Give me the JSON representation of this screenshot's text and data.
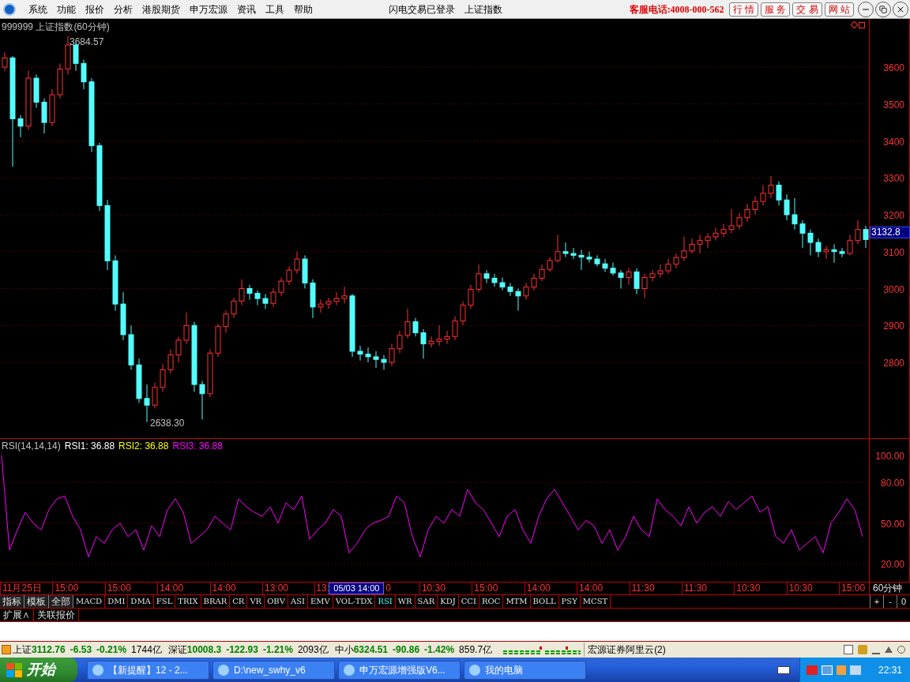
{
  "menu": {
    "items": [
      "系统",
      "功能",
      "报价",
      "分析",
      "港股期货",
      "申万宏源",
      "资讯",
      "工具",
      "帮助"
    ],
    "status": [
      "闪电交易已登录",
      "上证指数"
    ],
    "hotline": "客服电话:4008-000-562",
    "quick_buttons": [
      "行 情",
      "服 务",
      "交 易",
      "网 站"
    ]
  },
  "chart": {
    "title": "999999 上证指数(60分钟)",
    "high_label": "3684.57",
    "low_label": "2638.30",
    "current_price": "3132.8",
    "chart_data": {
      "type": "candlestick",
      "grid": true,
      "ylim": [
        2594.7,
        3730.5
      ],
      "yticks": [
        {
          "value": 3600,
          "label": "3600"
        },
        {
          "value": 3500,
          "label": "3500"
        },
        {
          "value": 3400,
          "label": "3400"
        },
        {
          "value": 3300,
          "label": "3300"
        },
        {
          "value": 3200,
          "label": "3200"
        },
        {
          "value": 3100,
          "label": "3100"
        },
        {
          "value": 3000,
          "label": "3000"
        },
        {
          "value": 2900,
          "label": "2900"
        },
        {
          "value": 2800,
          "label": "2800"
        }
      ],
      "ohlc": [
        [
          3600,
          3640,
          3590,
          3625
        ],
        [
          3625,
          3630,
          3330,
          3460
        ],
        [
          3460,
          3470,
          3410,
          3440
        ],
        [
          3440,
          3590,
          3430,
          3570
        ],
        [
          3570,
          3580,
          3490,
          3505
        ],
        [
          3505,
          3515,
          3420,
          3450
        ],
        [
          3450,
          3540,
          3440,
          3525
        ],
        [
          3525,
          3610,
          3515,
          3595
        ],
        [
          3595,
          3684.57,
          3580,
          3660
        ],
        [
          3660,
          3665,
          3590,
          3610
        ],
        [
          3610,
          3620,
          3540,
          3560
        ],
        [
          3560,
          3570,
          3370,
          3387
        ],
        [
          3387,
          3395,
          3210,
          3225
        ],
        [
          3225,
          3240,
          3050,
          3075
        ],
        [
          3075,
          3090,
          2940,
          2958
        ],
        [
          2958,
          2990,
          2860,
          2875
        ],
        [
          2875,
          2900,
          2780,
          2793
        ],
        [
          2793,
          2810,
          2690,
          2702
        ],
        [
          2702,
          2740,
          2638.3,
          2684
        ],
        [
          2684,
          2745,
          2675,
          2732
        ],
        [
          2732,
          2795,
          2720,
          2780
        ],
        [
          2780,
          2835,
          2770,
          2820
        ],
        [
          2820,
          2870,
          2800,
          2860
        ],
        [
          2860,
          2935,
          2850,
          2900
        ],
        [
          2900,
          2910,
          2720,
          2740
        ],
        [
          2740,
          2750,
          2645,
          2715
        ],
        [
          2715,
          2835,
          2705,
          2825
        ],
        [
          2825,
          2905,
          2815,
          2897
        ],
        [
          2897,
          2940,
          2880,
          2931
        ],
        [
          2931,
          2975,
          2920,
          2966
        ],
        [
          2966,
          3025,
          2955,
          3000
        ],
        [
          3000,
          3010,
          2970,
          2987
        ],
        [
          2987,
          2995,
          2955,
          2973
        ],
        [
          2973,
          2985,
          2945,
          2960
        ],
        [
          2960,
          3000,
          2950,
          2990
        ],
        [
          2990,
          3030,
          2980,
          3020
        ],
        [
          3020,
          3060,
          3010,
          3050
        ],
        [
          3050,
          3100,
          3040,
          3080
        ],
        [
          3080,
          3090,
          3000,
          3015
        ],
        [
          3015,
          3025,
          2920,
          2950
        ],
        [
          2950,
          2970,
          2935,
          2958
        ],
        [
          2958,
          2975,
          2945,
          2965
        ],
        [
          2965,
          2990,
          2955,
          2973
        ],
        [
          2973,
          3005,
          2960,
          2980
        ],
        [
          2980,
          2985,
          2815,
          2830
        ],
        [
          2830,
          2845,
          2805,
          2822
        ],
        [
          2822,
          2840,
          2800,
          2815
        ],
        [
          2815,
          2830,
          2785,
          2808
        ],
        [
          2808,
          2820,
          2780,
          2800
        ],
        [
          2800,
          2850,
          2790,
          2837
        ],
        [
          2837,
          2885,
          2825,
          2873
        ],
        [
          2873,
          2945,
          2865,
          2910
        ],
        [
          2910,
          2920,
          2870,
          2880
        ],
        [
          2880,
          2890,
          2810,
          2850
        ],
        [
          2850,
          2870,
          2840,
          2857
        ],
        [
          2857,
          2900,
          2845,
          2863
        ],
        [
          2863,
          2885,
          2850,
          2870
        ],
        [
          2870,
          2925,
          2860,
          2912
        ],
        [
          2912,
          2965,
          2900,
          2955
        ],
        [
          2955,
          3010,
          2945,
          2998
        ],
        [
          2998,
          3065,
          2990,
          3040
        ],
        [
          3040,
          3050,
          3015,
          3028
        ],
        [
          3028,
          3040,
          3005,
          3016
        ],
        [
          3016,
          3030,
          2995,
          3004
        ],
        [
          3004,
          3015,
          2980,
          2992
        ],
        [
          2992,
          3000,
          2940,
          2980
        ],
        [
          2980,
          3015,
          2970,
          3004
        ],
        [
          3004,
          3040,
          2995,
          3028
        ],
        [
          3028,
          3065,
          3020,
          3052
        ],
        [
          3052,
          3085,
          3045,
          3076
        ],
        [
          3076,
          3145,
          3070,
          3100
        ],
        [
          3100,
          3125,
          3085,
          3095
        ],
        [
          3095,
          3110,
          3080,
          3090
        ],
        [
          3090,
          3105,
          3050,
          3085
        ],
        [
          3085,
          3100,
          3070,
          3080
        ],
        [
          3080,
          3090,
          3060,
          3067
        ],
        [
          3067,
          3080,
          3045,
          3055
        ],
        [
          3055,
          3070,
          3035,
          3042
        ],
        [
          3042,
          3050,
          3000,
          3030
        ],
        [
          3030,
          3055,
          3010,
          3045
        ],
        [
          3045,
          3055,
          2985,
          3000
        ],
        [
          3000,
          3040,
          2975,
          3030
        ],
        [
          3030,
          3050,
          3020,
          3040
        ],
        [
          3040,
          3065,
          3030,
          3048
        ],
        [
          3048,
          3080,
          3040,
          3066
        ],
        [
          3066,
          3095,
          3055,
          3084
        ],
        [
          3084,
          3140,
          3075,
          3102
        ],
        [
          3102,
          3135,
          3095,
          3120
        ],
        [
          3120,
          3145,
          3095,
          3130
        ],
        [
          3130,
          3150,
          3110,
          3140
        ],
        [
          3140,
          3165,
          3130,
          3150
        ],
        [
          3150,
          3175,
          3140,
          3160
        ],
        [
          3160,
          3215,
          3150,
          3170
        ],
        [
          3170,
          3205,
          3160,
          3192
        ],
        [
          3192,
          3230,
          3180,
          3214
        ],
        [
          3214,
          3250,
          3200,
          3236
        ],
        [
          3236,
          3280,
          3225,
          3258
        ],
        [
          3258,
          3305,
          3245,
          3280
        ],
        [
          3280,
          3290,
          3225,
          3240
        ],
        [
          3240,
          3255,
          3185,
          3200
        ],
        [
          3200,
          3245,
          3160,
          3175
        ],
        [
          3175,
          3185,
          3110,
          3150
        ],
        [
          3150,
          3160,
          3090,
          3125
        ],
        [
          3125,
          3135,
          3085,
          3100
        ],
        [
          3100,
          3115,
          3080,
          3105
        ],
        [
          3105,
          3120,
          3070,
          3100
        ],
        [
          3100,
          3110,
          3085,
          3095
        ],
        [
          3095,
          3145,
          3090,
          3130
        ],
        [
          3130,
          3185,
          3120,
          3160
        ],
        [
          3160,
          3170,
          3110,
          3132.8
        ]
      ]
    }
  },
  "rsi": {
    "legend": [
      {
        "text": "RSI(14,14,14)",
        "color": "#c0c0c0"
      },
      {
        "text": "RSI1: 36.88",
        "color": "#ffffff"
      },
      {
        "text": "RSI2: 36.88",
        "color": "#ffff00"
      },
      {
        "text": "RSI3: 36.88",
        "color": "#ff00ff"
      }
    ],
    "chart_data": {
      "type": "line",
      "grid": true,
      "ylim": [
        6.6,
        112.3
      ],
      "yticks": [
        {
          "value": 100,
          "label": "100.00"
        },
        {
          "value": 80,
          "label": "80.00"
        },
        {
          "value": 50,
          "label": "50.00"
        },
        {
          "value": 20,
          "label": "20.00"
        }
      ],
      "series": [
        {
          "color": "#ff00ff",
          "values": [
            100,
            30,
            45,
            58,
            50,
            45,
            60,
            68,
            70,
            55,
            45,
            25,
            40,
            35,
            45,
            50,
            40,
            45,
            30,
            48,
            40,
            60,
            68,
            58,
            35,
            40,
            45,
            55,
            50,
            45,
            68,
            62,
            58,
            55,
            62,
            50,
            65,
            60,
            70,
            38,
            45,
            50,
            60,
            55,
            28,
            35,
            45,
            50,
            52,
            55,
            70,
            65,
            40,
            25,
            45,
            55,
            50,
            60,
            55,
            75,
            65,
            60,
            50,
            40,
            55,
            60,
            45,
            35,
            55,
            68,
            75,
            65,
            55,
            45,
            52,
            48,
            35,
            45,
            30,
            40,
            55,
            45,
            40,
            68,
            60,
            55,
            48,
            62,
            50,
            58,
            62,
            55,
            66,
            60,
            65,
            70,
            58,
            62,
            40,
            35,
            45,
            30,
            35,
            40,
            28,
            50,
            58,
            68,
            60,
            40
          ]
        }
      ]
    }
  },
  "time_axis": {
    "ticks": [
      {
        "label": "11月25日",
        "kind": "tick"
      },
      {
        "label": "15:00",
        "kind": "tick"
      },
      {
        "label": "15:00",
        "kind": "tick"
      },
      {
        "label": "14:00",
        "kind": "tick"
      },
      {
        "label": "14:00",
        "kind": "tick"
      },
      {
        "label": "13:00",
        "kind": "tick"
      },
      {
        "label": "13:",
        "kind": "head"
      },
      {
        "label": "05/03 14:00",
        "kind": "cursor"
      },
      {
        "label": "0",
        "kind": "tail"
      },
      {
        "label": "10:30",
        "kind": "tick"
      },
      {
        "label": "15:00",
        "kind": "tick"
      },
      {
        "label": "14:00",
        "kind": "tick"
      },
      {
        "label": "14:00",
        "kind": "tick"
      },
      {
        "label": "11:30",
        "kind": "tick"
      },
      {
        "label": "11:30",
        "kind": "tick"
      },
      {
        "label": "10:30",
        "kind": "tick"
      },
      {
        "label": "10:30",
        "kind": "tick"
      },
      {
        "label": "15:00",
        "kind": "tick"
      }
    ],
    "period": "60分钟"
  },
  "indicator_tabs": {
    "groups": [
      "指标",
      "模板",
      "全部"
    ],
    "tabs": [
      {
        "label": "MACD",
        "selected": false
      },
      {
        "label": "DMI",
        "selected": false
      },
      {
        "label": "DMA",
        "selected": false
      },
      {
        "label": "FSL",
        "selected": false
      },
      {
        "label": "TRIX",
        "selected": false
      },
      {
        "label": "BRAR",
        "selected": false
      },
      {
        "label": "CR",
        "selected": false
      },
      {
        "label": "VR",
        "selected": false
      },
      {
        "label": "OBV",
        "selected": false
      },
      {
        "label": "ASI",
        "selected": false
      },
      {
        "label": "EMV",
        "selected": false
      },
      {
        "label": "VOL-TDX",
        "selected": false
      },
      {
        "label": "RSI",
        "selected": true
      },
      {
        "label": "WR",
        "selected": false
      },
      {
        "label": "SAR",
        "selected": false
      },
      {
        "label": "KDJ",
        "selected": false
      },
      {
        "label": "CCI",
        "selected": false
      },
      {
        "label": "ROC",
        "selected": false
      },
      {
        "label": "MTM",
        "selected": false
      },
      {
        "label": "BOLL",
        "selected": false
      },
      {
        "label": "PSY",
        "selected": false
      },
      {
        "label": "MCST",
        "selected": false
      }
    ],
    "zoom_buttons": [
      "+",
      "-",
      "0"
    ]
  },
  "bottom_tabs": [
    "扩展∧",
    "关联报价"
  ],
  "status_bar": {
    "indices": [
      {
        "name": "上证",
        "value": "3112.76",
        "change": "-6.53",
        "percent": "-0.21%",
        "amount": "1744亿"
      },
      {
        "name": "深证",
        "value": "10008.3",
        "change": "-122.93",
        "percent": "-1.21%",
        "amount": "2093亿"
      },
      {
        "name": "中小",
        "value": "6324.51",
        "change": "-90.86",
        "percent": "-1.42%",
        "amount": "859.7亿"
      }
    ],
    "server": "宏源证券阿里云(2)"
  },
  "taskbar": {
    "start": "开始",
    "tasks": [
      "【新提醒】12 - 2...",
      "D:\\new_swhy_v6",
      "申万宏源增强版V6...",
      "我的电脑"
    ],
    "clock": "22:31"
  }
}
